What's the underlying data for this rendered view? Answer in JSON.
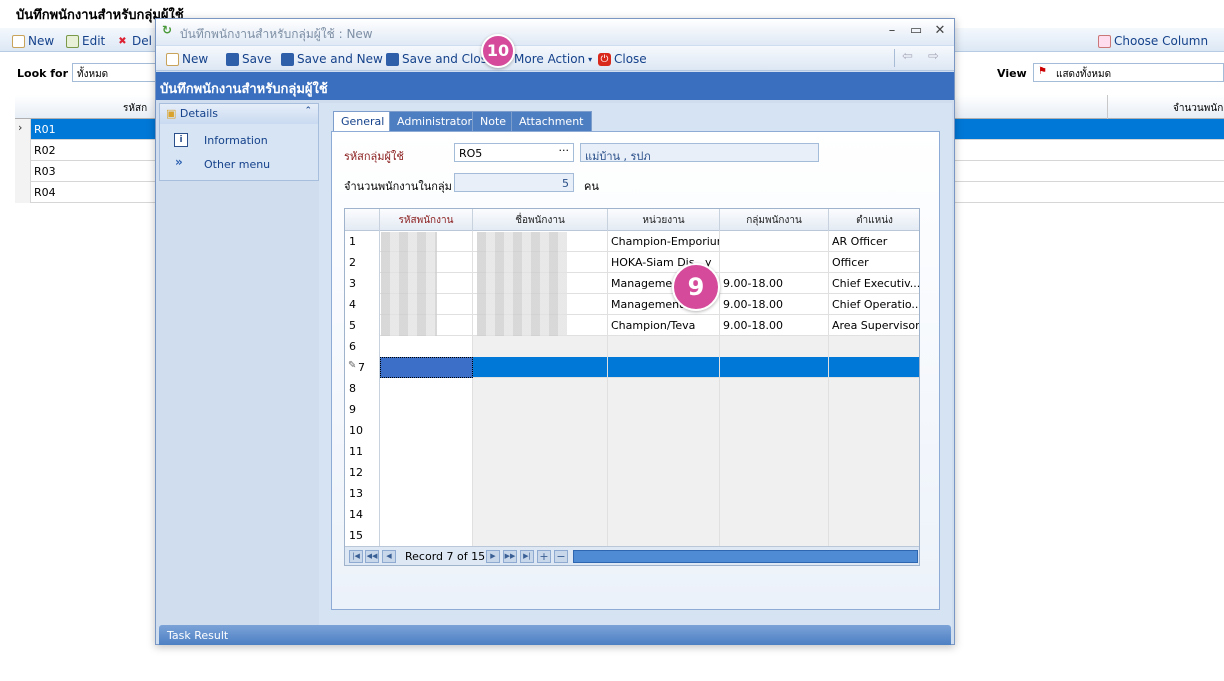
{
  "background": {
    "title": "บันทึกพนักงานสำหรับกลุ่มผู้ใช้",
    "toolbar": {
      "new": "New",
      "edit": "Edit",
      "delete": "Del",
      "choose_column": "Choose Column"
    },
    "filter": {
      "look_for_label": "Look for",
      "look_for_value": "ทั้งหมด",
      "view_label": "View",
      "view_value": "แสดงทั้งหมด"
    },
    "grid": {
      "col1_header": "รหัสก",
      "col_right_header": "จำนวนพนัก",
      "rows": [
        "R01",
        "R02",
        "R03",
        "R04"
      ]
    }
  },
  "window": {
    "title": "บันทึกพนักงานสำหรับกลุ่มผู้ใช้ : New",
    "toolbar": {
      "new": "New",
      "save": "Save",
      "save_new": "Save and New",
      "save_close": "Save and Close",
      "more_action": "More Action",
      "close": "Close"
    },
    "band_title": "บันทึกพนักงานสำหรับกลุ่มผู้ใช้",
    "side": {
      "header": "Details",
      "items": [
        "Information",
        "Other menu"
      ]
    },
    "tabs": [
      "General",
      "Administrator",
      "Note",
      "Attachment"
    ],
    "form": {
      "group_code_label": "รหัสกลุ่มผู้ใช้",
      "group_code_value": "RO5",
      "group_name_value": "แม่บ้าน , รปภ",
      "count_label": "จำนวนพนักงานในกลุ่ม",
      "count_value": "5",
      "count_unit": "คน"
    },
    "grid": {
      "headers": [
        "รหัสพนักงาน",
        "ชื่อพนักงาน",
        "หน่วยงาน",
        "กลุ่มพนักงาน",
        "ตำแหน่ง"
      ],
      "rows": [
        {
          "n": "1",
          "dept": "Champion-Emporium",
          "group": "",
          "pos": "AR Officer"
        },
        {
          "n": "2",
          "dept": "HOKA-Siam Dis...y",
          "group": "",
          "pos": "Officer"
        },
        {
          "n": "3",
          "dept": "Managemen",
          "group": "9.00-18.00",
          "pos": "Chief Executiv..."
        },
        {
          "n": "4",
          "dept": "Management",
          "group": "9.00-18.00",
          "pos": "Chief Operatio..."
        },
        {
          "n": "5",
          "dept": "Champion/Teva",
          "group": "9.00-18.00",
          "pos": "Area Supervisor"
        },
        {
          "n": "6",
          "dept": "",
          "group": "",
          "pos": ""
        },
        {
          "n": "7",
          "dept": "",
          "group": "",
          "pos": ""
        },
        {
          "n": "8",
          "dept": "",
          "group": "",
          "pos": ""
        },
        {
          "n": "9",
          "dept": "",
          "group": "",
          "pos": ""
        },
        {
          "n": "10",
          "dept": "",
          "group": "",
          "pos": ""
        },
        {
          "n": "11",
          "dept": "",
          "group": "",
          "pos": ""
        },
        {
          "n": "12",
          "dept": "",
          "group": "",
          "pos": ""
        },
        {
          "n": "13",
          "dept": "",
          "group": "",
          "pos": ""
        },
        {
          "n": "14",
          "dept": "",
          "group": "",
          "pos": ""
        },
        {
          "n": "15",
          "dept": "",
          "group": "",
          "pos": ""
        }
      ],
      "record_text": "Record 7 of 15"
    },
    "task_result": "Task Result"
  },
  "badges": {
    "nine": "9",
    "ten": "10"
  },
  "colors": {
    "accent": "#3a6fbf",
    "selection": "#0078d7",
    "badge": "#d54a9a"
  }
}
